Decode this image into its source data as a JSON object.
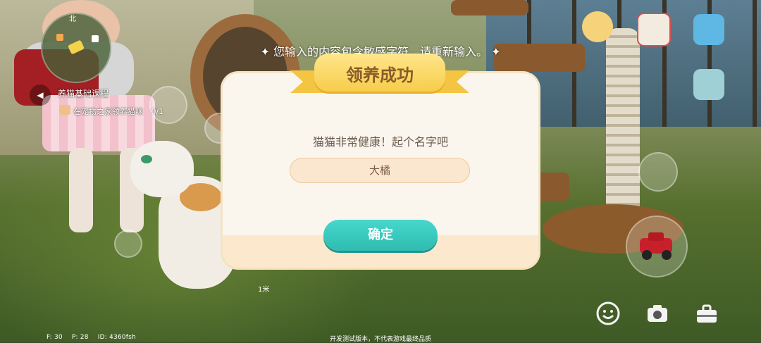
{
  "hud": {
    "minimap_north": "北",
    "quest_title": "养猫基础课程",
    "quest_task": "在宠物之家领养猫咪",
    "quest_progress": "0/1",
    "distance": "1米",
    "stats": {
      "f": "F: 30",
      "p": "P: 28",
      "id": "ID: 4360fsh"
    },
    "disclaimer": "开发测试版本，不代表游戏最终品质"
  },
  "toast": "✦ 您输入的内容包含敏感字符，请重新输入。 ✦",
  "dialog": {
    "title": "领养成功",
    "prompt": "猫猫非常健康！起个名字吧",
    "name_value": "大橘",
    "confirm_label": "确定"
  },
  "icons": {
    "top_right": [
      "duck-avatar-icon",
      "shopping-basket-icon",
      "phone-app-icon",
      "backpack-icon"
    ],
    "bottom": [
      "emote-icon",
      "camera-icon",
      "toolbox-icon"
    ],
    "side": [
      "sprint-icon",
      "vehicle-car-icon"
    ]
  }
}
